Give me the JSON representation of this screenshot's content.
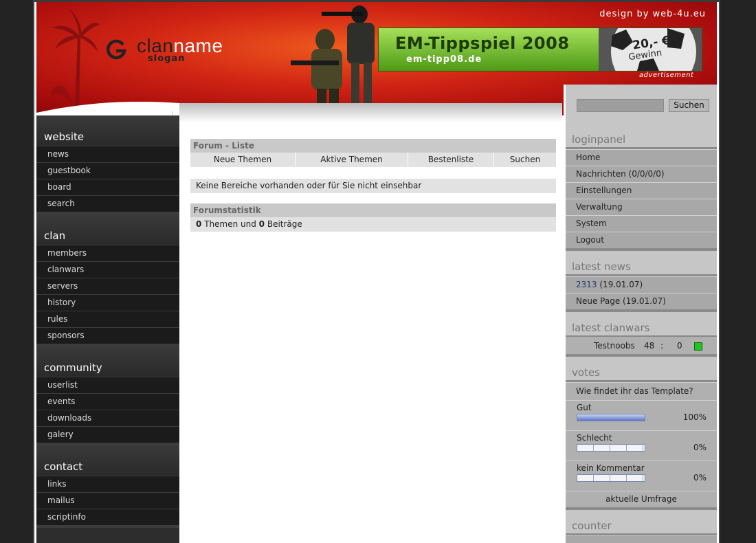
{
  "header": {
    "logo_name_dark": "clan",
    "logo_name_light": "name",
    "slogan": "slogan",
    "credit": "design by web-4u.eu",
    "banner_title": "EM-Tippspiel 2008",
    "banner_url": "em-tipp08.de",
    "banner_badge_amount": "20,- €",
    "banner_badge_text": "Gewinn",
    "ad_label": "advertisement"
  },
  "leftnav": {
    "groups": [
      {
        "title": "website",
        "items": [
          "news",
          "guestbook",
          "board",
          "search"
        ]
      },
      {
        "title": "clan",
        "items": [
          "members",
          "clanwars",
          "servers",
          "history",
          "rules",
          "sponsors"
        ]
      },
      {
        "title": "community",
        "items": [
          "userlist",
          "events",
          "downloads",
          "galery"
        ]
      },
      {
        "title": "contact",
        "items": [
          "links",
          "mailus",
          "scriptinfo"
        ]
      }
    ]
  },
  "content": {
    "forum_title": "Forum - Liste",
    "tabs": [
      "Neue Themen",
      "Aktive Themen",
      "Bestenliste",
      "Suchen"
    ],
    "message": "Keine Bereiche vorhanden oder für Sie nicht einsehbar",
    "stats_title": "Forumstatistik",
    "stats_themes": "0",
    "stats_themes_label": "Themen und",
    "stats_posts": "0",
    "stats_posts_label": "Beiträge"
  },
  "right": {
    "search_button": "Suchen",
    "search_value": "",
    "loginpanel_title": "loginpanel",
    "loginpanel_items": [
      "Home",
      "Nachrichten (0/0/0/0)",
      "Einstellungen",
      "Verwaltung",
      "System",
      "Logout"
    ],
    "latest_news_title": "latest news",
    "news": [
      {
        "title": "2313",
        "date": "(19.01.07)"
      },
      {
        "title": "Neue Page",
        "date": "(19.01.07)"
      }
    ],
    "latest_clanwars_title": "latest clanwars",
    "clanwar": {
      "opponent": "Testnoobs",
      "score_home": "48",
      "separator": ":",
      "score_away": "0",
      "result_color": "#22c422"
    },
    "votes_title": "votes",
    "vote_question": "Wie findet ihr das Template?",
    "vote_options": [
      {
        "label": "Gut",
        "percent_text": "100%",
        "fraction": 1.0
      },
      {
        "label": "Schlecht",
        "percent_text": "0%",
        "fraction": 0.0
      },
      {
        "label": "kein Kommentar",
        "percent_text": "0%",
        "fraction": 0.0
      }
    ],
    "vote_link": "aktuelle Umfrage",
    "counter_title": "counter"
  },
  "colors": {
    "header_red": "#d02414",
    "nav_dark": "#1b1b1b",
    "right_gray": "#a8a8a8",
    "banner_green": "#6ab82a"
  }
}
